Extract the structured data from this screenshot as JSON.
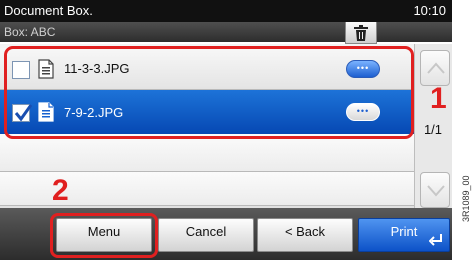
{
  "header": {
    "title": "Document Box.",
    "clock": "10:10",
    "subtitle": "Box: ABC"
  },
  "file_list": [
    {
      "name": "11-3-3.JPG",
      "checked": false,
      "selected": false
    },
    {
      "name": "7-9-2.JPG",
      "checked": true,
      "selected": true
    }
  ],
  "detail_button_glyph": "•••",
  "scroll": {
    "page_indicator": "1/1"
  },
  "callouts": {
    "one": "1",
    "two": "2"
  },
  "toolbar": {
    "menu_label": "Menu",
    "cancel_label": "Cancel",
    "back_label": "< Back",
    "print_label": "Print"
  },
  "side_label": "3R1089_00",
  "icons": {
    "trash": "trash-icon",
    "file": "document-icon",
    "check": "check-icon",
    "scroll_up": "chevron-up-icon",
    "scroll_down": "chevron-down-icon",
    "enter": "enter-icon"
  },
  "colors": {
    "selection": "#1560d0",
    "callout": "#e02020",
    "print_button": "#1d6ae0"
  }
}
